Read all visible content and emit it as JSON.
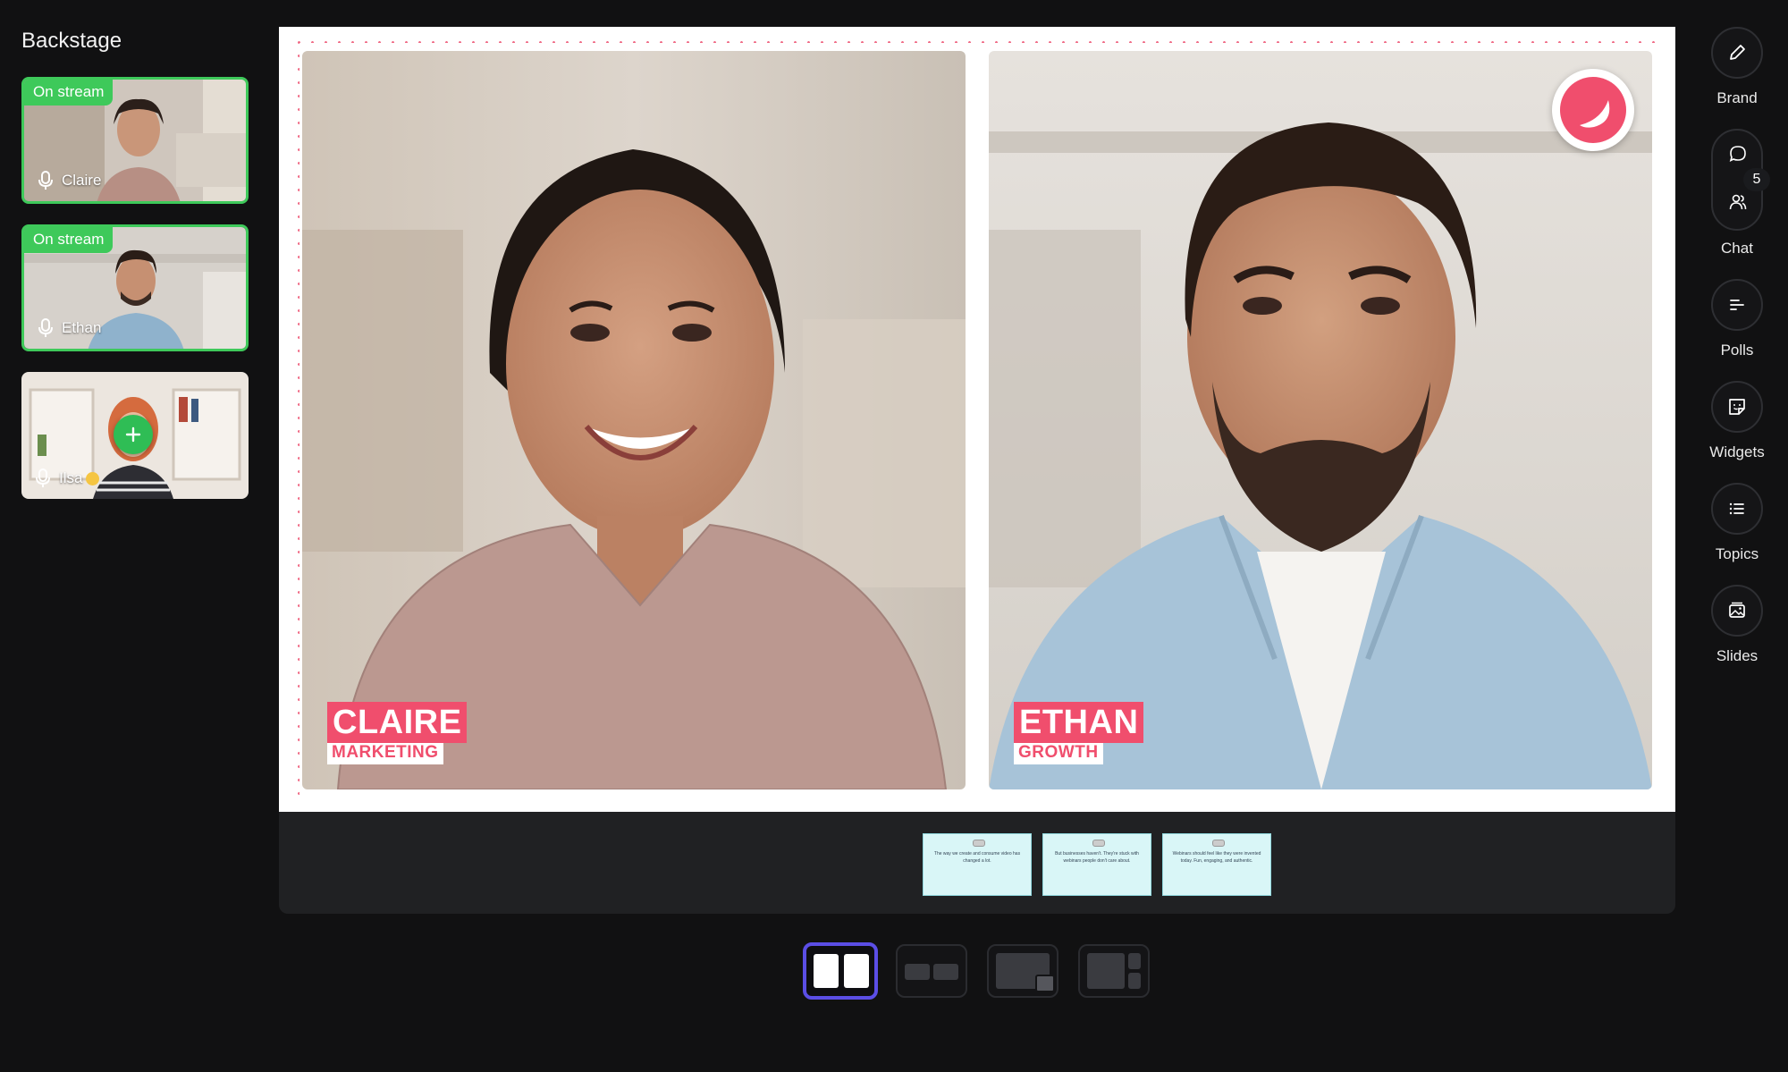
{
  "backstage": {
    "title": "Backstage",
    "participants": [
      {
        "name": "Claire",
        "status": "On stream"
      },
      {
        "name": "Ethan",
        "status": "On stream"
      },
      {
        "name": "Ilsa",
        "status": ""
      }
    ]
  },
  "stage": {
    "speakers": [
      {
        "name": "CLAIRE",
        "role": "MARKETING"
      },
      {
        "name": "ETHAN",
        "role": "GROWTH"
      }
    ],
    "accent_color": "#f04e6d"
  },
  "slides": [
    {
      "text": "The way we create and consume video has changed a lot."
    },
    {
      "text": "But businesses haven't. They're stuck with webinars people don't care about."
    },
    {
      "text": "Webinars should feel like they were invented today. Fun, engaging, and authentic."
    }
  ],
  "tools": {
    "brand": "Brand",
    "chat": "Chat",
    "chat_count": "5",
    "polls": "Polls",
    "widgets": "Widgets",
    "topics": "Topics",
    "slides": "Slides"
  },
  "colors": {
    "on_stream": "#3ec95a",
    "layout_active": "#5b4ee6"
  }
}
